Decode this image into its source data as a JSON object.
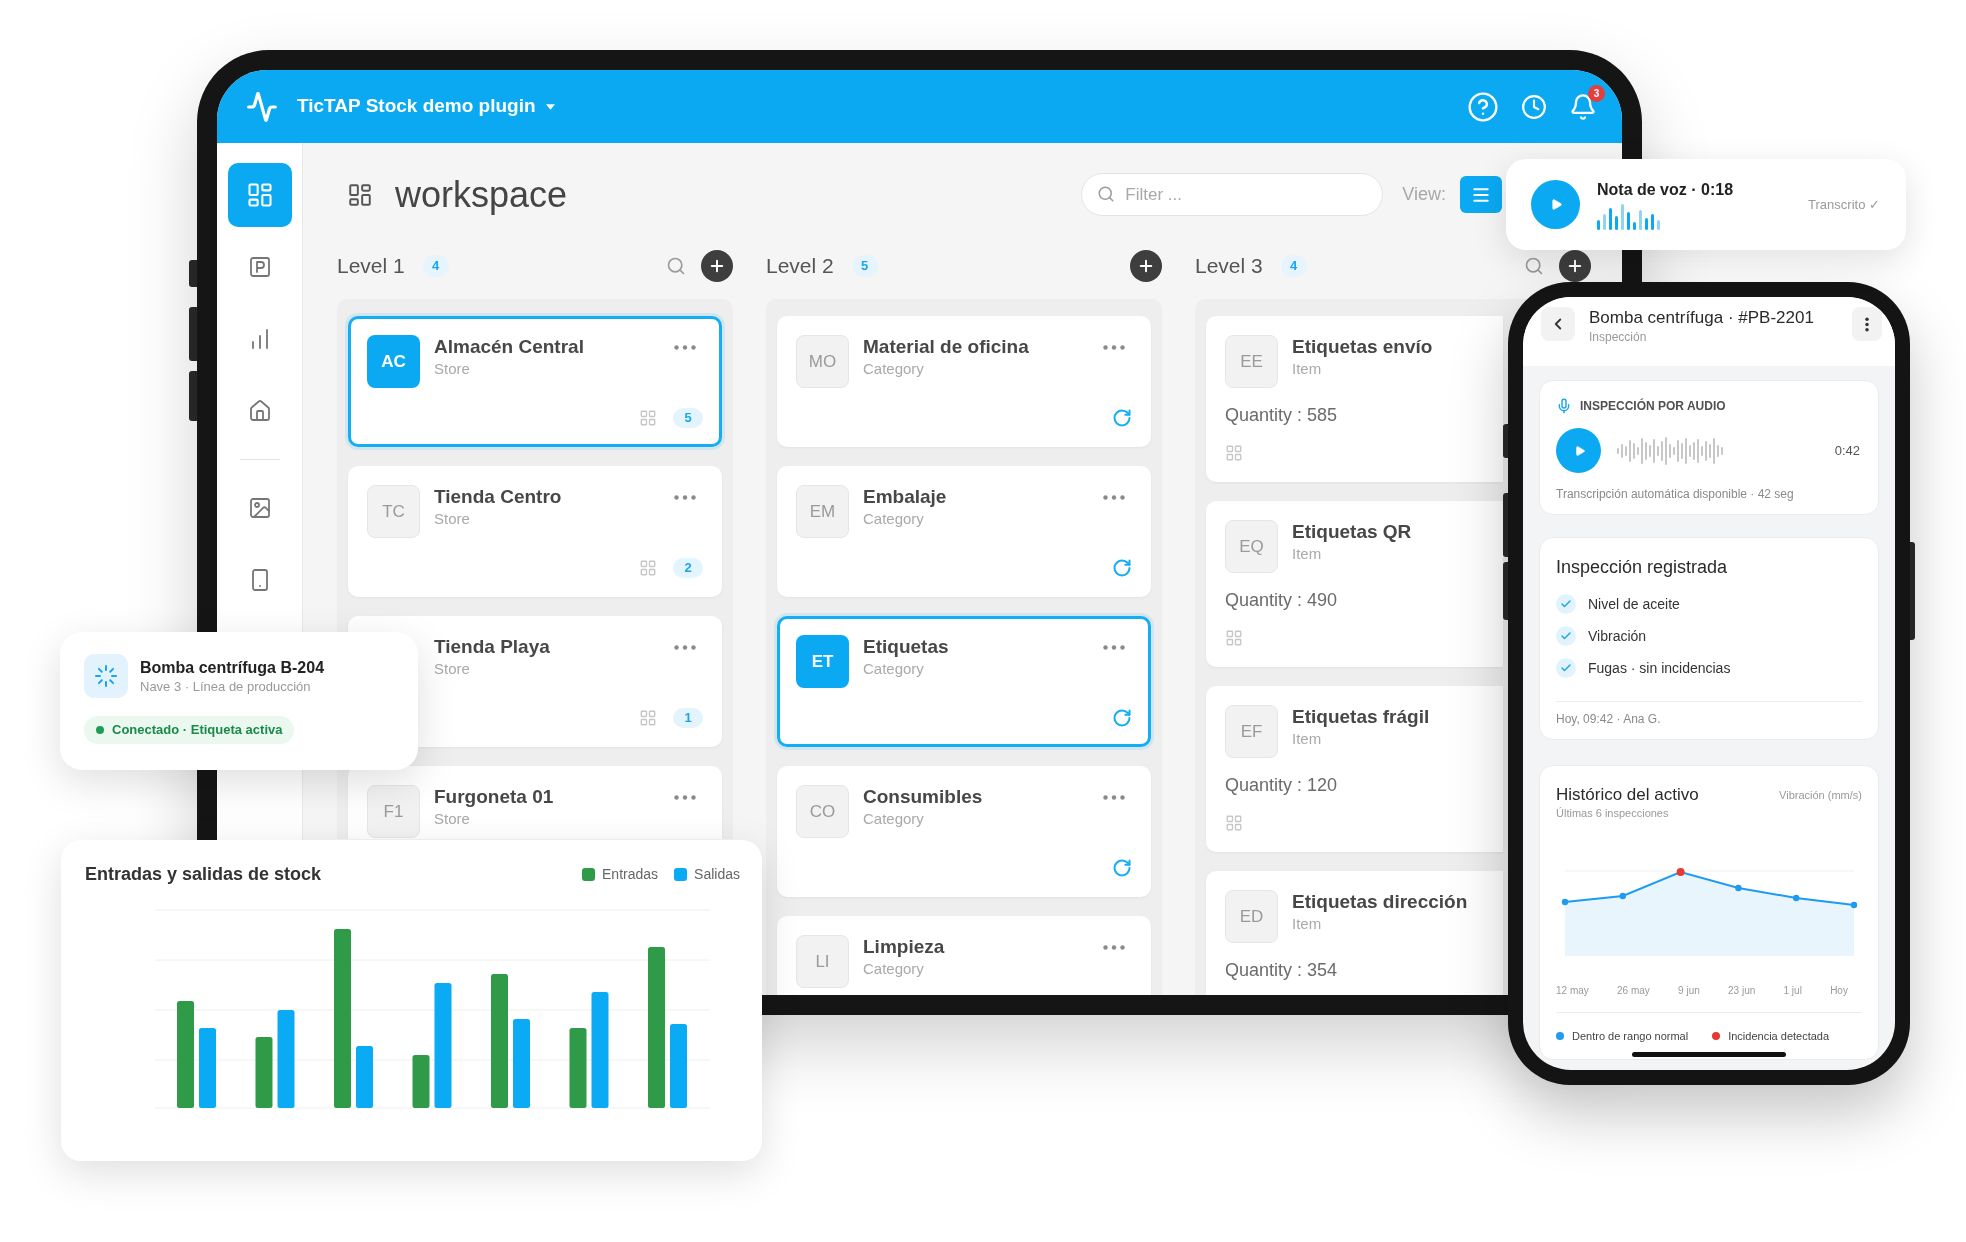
{
  "tablet": {
    "app_bar": {
      "title": "TicTAP Stock demo plugin",
      "notifications": "3"
    },
    "sidebar": {
      "groups": [
        {
          "items": [
            {
              "selected": true
            },
            {
              "selected": false
            },
            {
              "selected": false
            },
            {
              "selected": false
            }
          ]
        },
        {
          "items": [
            {
              "selected": false
            },
            {
              "selected": false
            }
          ]
        }
      ]
    },
    "workspace": {
      "title": "workspace",
      "filter": {
        "placeholder": "Filter ..."
      },
      "view_label": "View:"
    },
    "levels": [
      {
        "title": "Level 1",
        "count": "4",
        "search": true,
        "kind": "stores",
        "cards": [
          {
            "initials": "AC",
            "name": "Almacén Central",
            "type": "Store",
            "selected": true,
            "menu": true,
            "count": "5"
          },
          {
            "initials": "TC",
            "name": "Tienda Centro",
            "type": "Store",
            "selected": false,
            "menu": true,
            "count": "2"
          },
          {
            "name": "Tienda Playa",
            "type": "Store",
            "selected": false,
            "menu": true,
            "count": "1"
          },
          {
            "initials": "F1",
            "name": "Furgoneta 01",
            "type": "Store",
            "selected": false,
            "menu": true
          }
        ]
      },
      {
        "title": "Level 2",
        "count": "5",
        "search": false,
        "kind": "categories",
        "cards": [
          {
            "initials": "MO",
            "name": "Material de oficina",
            "type": "Category",
            "selected": false,
            "menu": true,
            "refresh": true
          },
          {
            "initials": "EM",
            "name": "Embalaje",
            "type": "Category",
            "selected": false,
            "menu": true,
            "refresh": true
          },
          {
            "initials": "ET",
            "name": "Etiquetas",
            "type": "Category",
            "selected": true,
            "menu": true,
            "refresh": true
          },
          {
            "initials": "CO",
            "name": "Consumibles",
            "type": "Category",
            "selected": false,
            "menu": true,
            "refresh": true
          },
          {
            "initials": "LI",
            "name": "Limpieza",
            "type": "Category",
            "selected": false,
            "menu": true
          }
        ]
      },
      {
        "title": "Level 3",
        "count": "4",
        "search": true,
        "kind": "items",
        "cards": [
          {
            "initials": "EE",
            "name": "Etiquetas envío",
            "type": "Item",
            "selected": false,
            "quantity": "Quantity : 585",
            "grid": true
          },
          {
            "initials": "EQ",
            "name": "Etiquetas QR",
            "type": "Item",
            "selected": false,
            "quantity": "Quantity : 490",
            "grid": true
          },
          {
            "initials": "EF",
            "name": "Etiquetas frágil",
            "type": "Item",
            "selected": false,
            "quantity": "Quantity : 120",
            "grid": true
          },
          {
            "initials": "ED",
            "name": "Etiquetas dirección",
            "type": "Item",
            "selected": false,
            "quantity": "Quantity : 354"
          }
        ]
      }
    ]
  },
  "voice_note_card": {
    "title": "Nota de voz · 0:18",
    "status": "Transcrito ✓"
  },
  "phone": {
    "header": {
      "title": "Bomba centrífuga · #PB-2201",
      "subtitle": "Inspección"
    },
    "audio_card": {
      "heading": "INSPECCIÓN POR AUDIO",
      "duration": "0:42",
      "note": "Transcripción automática disponible · 42 seg"
    },
    "inspection_card": {
      "title": "Inspección registrada",
      "checks": [
        {
          "label": "Nivel de aceite",
          "checked": true
        },
        {
          "label": "Vibración",
          "checked": true
        },
        {
          "label": "Fugas · sin incidencias",
          "checked": true
        }
      ],
      "footer": "Hoy, 09:42 · Ana G."
    },
    "history_card": {
      "title": "Histórico del activo",
      "unit": "Vibración (mm/s)",
      "subtitle": "Últimas 6 inspecciones",
      "points": [
        {
          "label": "12 may",
          "incident": false
        },
        {
          "label": "26 may",
          "incident": false
        },
        {
          "label": "9 jun",
          "incident": true
        },
        {
          "label": "23 jun",
          "incident": false
        },
        {
          "label": "1 jul",
          "incident": false
        },
        {
          "label": "Hoy",
          "incident": false
        }
      ],
      "legend": [
        {
          "label": "Dentro de rango normal",
          "color": "#1e9bf0"
        },
        {
          "label": "Incidencia detectada",
          "color": "#e53935"
        }
      ]
    }
  },
  "asset_card": {
    "title": "Bomba centrífuga B-204",
    "subtitle": "Nave 3 · Línea de producción",
    "status": "Conectado · Etiqueta activa"
  },
  "stock_chart_card": {
    "title": "Entradas y salidas de stock",
    "legend": [
      {
        "label": "Entradas",
        "color": "#2f9a48"
      },
      {
        "label": "Salidas",
        "color": "#0aaaf5"
      }
    ]
  }
}
